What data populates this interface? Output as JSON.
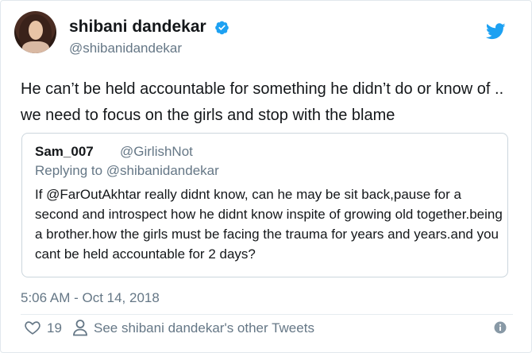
{
  "tweet": {
    "author_name": "shibani dandekar",
    "author_handle": "@shibanidandekar",
    "text": "He can’t be held accountable for something he didn’t do or know of .. we need to focus on the girls and stop with the blame",
    "timestamp": "5:06 AM - Oct 14, 2018",
    "like_count": "19",
    "other_tweets_link": "See shibani dandekar's other Tweets"
  },
  "quoted_tweet": {
    "author_name": "Sam_007",
    "author_handle": "@GirlishNot",
    "replying_to": "Replying to @shibanidandekar",
    "text": "If @FarOutAkhtar really didnt know, can he may be sit back,pause for a second and introspect how he didnt know inspite of growing old together.being a brother.how the girls must be facing the trauma for years and years.and you cant be held accountable for 2 days?"
  },
  "colors": {
    "twitter_blue": "#1da1f2",
    "secondary_text": "#657786",
    "border": "#ccd6dd"
  },
  "icons": {
    "verified": "verified-badge-icon",
    "brand": "twitter-bird-icon",
    "like": "heart-icon",
    "profile": "person-icon",
    "info": "info-icon"
  }
}
